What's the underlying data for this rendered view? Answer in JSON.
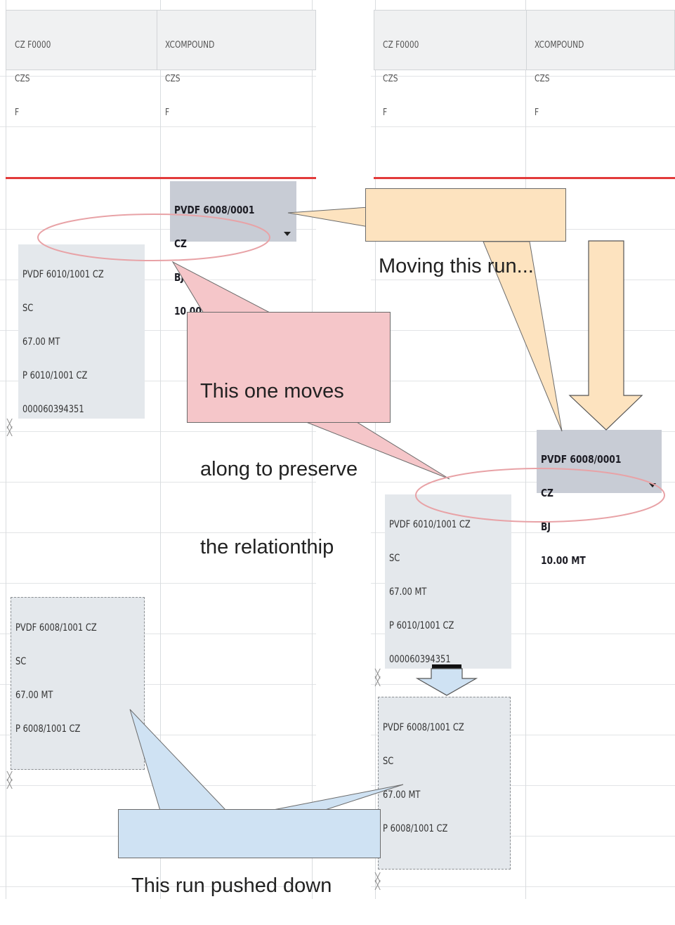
{
  "left_panel": {
    "columns": [
      {
        "line1": "CZ F0000",
        "line2": "CZS",
        "line3": "F"
      },
      {
        "line1": "XCOMPOUND",
        "line2": "CZS",
        "line3": "F"
      }
    ],
    "runs": {
      "moved_run": {
        "l1": "PVDF 6008/0001",
        "l2": "CZ",
        "l3": "BJ",
        "l4": "10.00 MT"
      },
      "related_run": {
        "l1": "PVDF 6010/1001 CZ",
        "l2": "SC",
        "l3": "67.00 MT",
        "l4": "P 6010/1001 CZ",
        "l5": "000060394351"
      },
      "pushed_run": {
        "l1": "PVDF 6008/1001 CZ",
        "l2": "SC",
        "l3": "67.00 MT",
        "l4": "P 6008/1001 CZ"
      }
    }
  },
  "right_panel": {
    "columns": [
      {
        "line1": "CZ F0000",
        "line2": "CZS",
        "line3": "F"
      },
      {
        "line1": "XCOMPOUND",
        "line2": "CZS",
        "line3": "F"
      }
    ],
    "runs": {
      "moved_run": {
        "l1": "PVDF 6008/0001",
        "l2": "CZ",
        "l3": "BJ",
        "l4": "10.00 MT"
      },
      "related_run": {
        "l1": "PVDF 6010/1001 CZ",
        "l2": "SC",
        "l3": "67.00 MT",
        "l4": "P 6010/1001 CZ",
        "l5": "000060394351"
      },
      "pushed_run": {
        "l1": "PVDF 6008/1001 CZ",
        "l2": "SC",
        "l3": "67.00 MT",
        "l4": "P 6008/1001 CZ"
      }
    }
  },
  "callouts": {
    "moving": "Moving this run...",
    "moves_along_1": "This one moves",
    "moves_along_2": "along to preserve",
    "moves_along_3": "the relationthip",
    "pushed": "This run pushed down"
  },
  "colors": {
    "orange_callout": "#fde3bf",
    "red_callout": "#f5c6c9",
    "blue_callout": "#cfe2f3",
    "time_marker": "#e23b3b",
    "run_fill": "#e4e8ec",
    "selected_run_fill": "#c8ccd5"
  }
}
